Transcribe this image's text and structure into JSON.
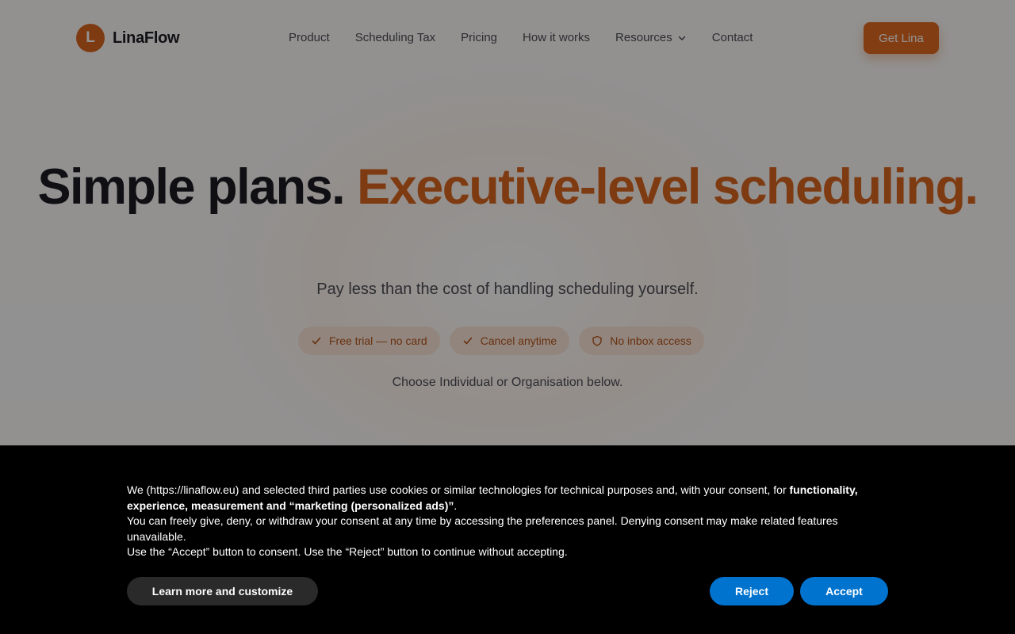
{
  "brand": {
    "logo_letter": "L",
    "name": "LinaFlow"
  },
  "nav": {
    "items": [
      "Product",
      "Scheduling Tax",
      "Pricing",
      "How it works",
      "Resources",
      "Contact"
    ],
    "cta_label": "Get Lina"
  },
  "hero": {
    "title_plain": "Simple plans. ",
    "title_accent": "Executive-level scheduling.",
    "subtitle": "Pay less than the cost of handling scheduling yourself.",
    "pills": [
      "Free trial — no card",
      "Cancel anytime",
      "No inbox access"
    ],
    "choose_text": "Choose Individual or Organisation below."
  },
  "cookie": {
    "line1_prefix": "We (https://linaflow.eu) and selected third parties use cookies or similar technologies for technical purposes and, with your consent, for ",
    "line1_bold": "functionality, experience, measurement and “marketing (personalized ads)”",
    "line1_suffix": ".",
    "line2": "You can freely give, deny, or withdraw your consent at any time by accessing the preferences panel. Denying consent may make related features unavailable.",
    "line3": "Use the “Accept” button to consent. Use the “Reject” button to continue without accepting.",
    "learn_label": "Learn more and customize",
    "reject_label": "Reject",
    "accept_label": "Accept"
  },
  "colors": {
    "accent": "#d9661f",
    "cta": "#e06a21",
    "consent_button": "#0073ce",
    "banner_bg": "#000000"
  },
  "icons": {
    "pill_0": "check-icon",
    "pill_1": "check-icon",
    "pill_2": "shield-icon",
    "resources": "chevron-down-icon"
  }
}
